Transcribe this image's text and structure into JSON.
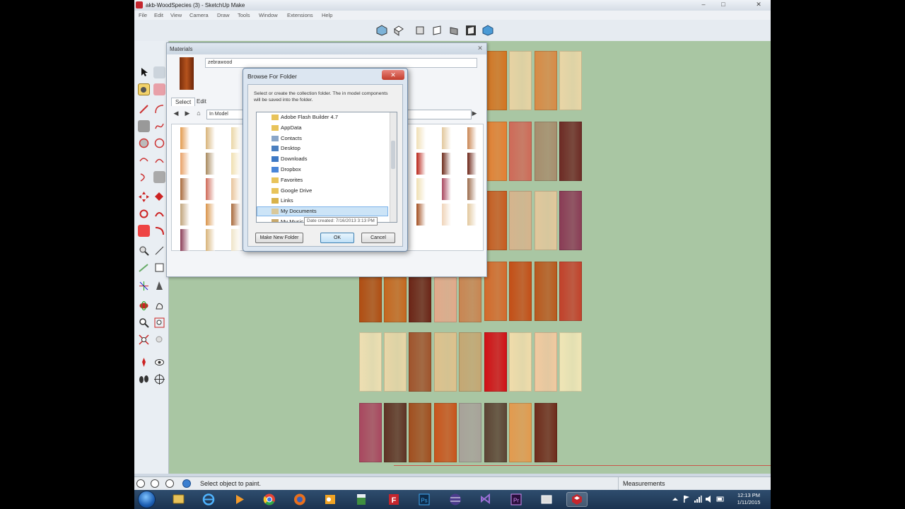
{
  "window": {
    "title": "akb-WoodSpecies (3) - SketchUp Make",
    "menu": [
      "File",
      "Edit",
      "View",
      "Camera",
      "Draw",
      "Tools",
      "Window",
      "Extensions",
      "Help"
    ]
  },
  "materials_panel": {
    "title": "Materials",
    "material_name": "zebrawood",
    "tabs": [
      "Select",
      "Edit"
    ],
    "collection": "In Model"
  },
  "browse_dialog": {
    "title": "Browse For Folder",
    "description": "Select or create the collection folder.  The in model components will be saved into the folder.",
    "tree": [
      {
        "label": "Adobe Flash Builder 4.7",
        "icon": "folder-icon"
      },
      {
        "label": "AppData",
        "icon": "folder-icon"
      },
      {
        "label": "Contacts",
        "icon": "contacts-icon"
      },
      {
        "label": "Desktop",
        "icon": "desktop-icon"
      },
      {
        "label": "Downloads",
        "icon": "downloads-icon"
      },
      {
        "label": "Dropbox",
        "icon": "dropbox-icon"
      },
      {
        "label": "Favorites",
        "icon": "favorites-icon"
      },
      {
        "label": "Google Drive",
        "icon": "google-drive-icon"
      },
      {
        "label": "Links",
        "icon": "links-icon"
      },
      {
        "label": "My Documents",
        "icon": "documents-icon",
        "selected": true
      },
      {
        "label": "My Music",
        "icon": "music-icon"
      }
    ],
    "tooltip": "Date created: 7/16/2013 3:13 PM",
    "buttons": {
      "make_new_folder": "Make New Folder",
      "ok": "OK",
      "cancel": "Cancel"
    }
  },
  "status": {
    "hint": "Select object to paint.",
    "measurements_label": "Measurements"
  },
  "taskbar": {
    "time": "12:13 PM",
    "date": "1/11/2015",
    "apps": [
      "windows-explorer",
      "internet-explorer",
      "media-player",
      "chrome",
      "firefox",
      "outlook",
      "excel",
      "filezilla",
      "photoshop",
      "eclipse",
      "visual-studio",
      "premiere",
      "window",
      "sketchup"
    ]
  }
}
